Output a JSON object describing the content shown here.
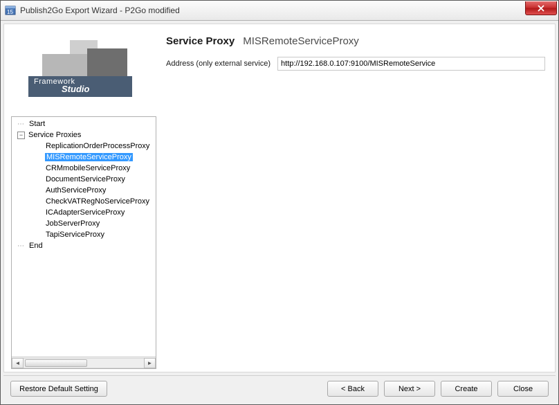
{
  "window": {
    "title": "Publish2Go Export Wizard - P2Go modified"
  },
  "logo": {
    "line1": "Framework",
    "line2": "Studio"
  },
  "tree": {
    "root_start": "Start",
    "root_proxies": "Service Proxies",
    "root_end": "End",
    "items": [
      "ReplicationOrderProcessProxy",
      "MISRemoteServiceProxy",
      "CRMmobileServiceProxy",
      "DocumentServiceProxy",
      "AuthServiceProxy",
      "CheckVATRegNoServiceProxy",
      "ICAdapterServiceProxy",
      "JobServerProxy",
      "TapiServiceProxy"
    ],
    "selected_index": 1
  },
  "main": {
    "heading_label": "Service Proxy",
    "heading_name": "MISRemoteServiceProxy",
    "address_label": "Address (only external service)",
    "address_value": "http://192.168.0.107:9100/MISRemoteService"
  },
  "footer": {
    "restore": "Restore Default Setting",
    "back": "< Back",
    "next": "Next >",
    "create": "Create",
    "close": "Close"
  }
}
